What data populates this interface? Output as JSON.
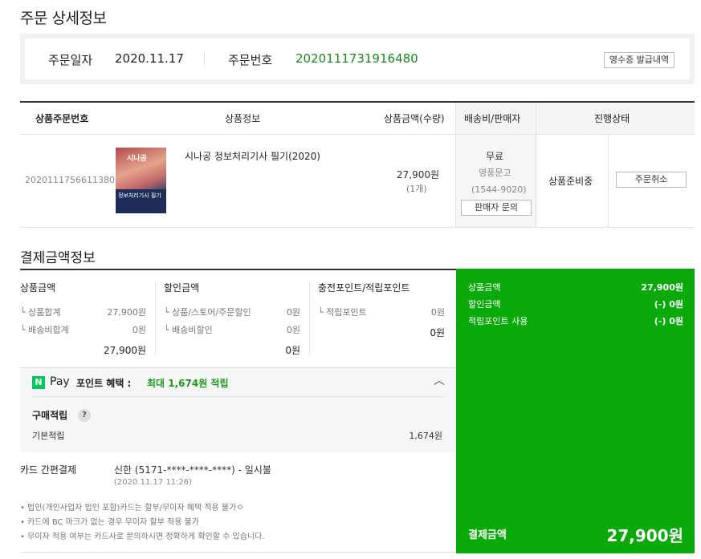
{
  "page_title": "주문 상세정보",
  "order_info": {
    "date_label": "주문일자",
    "date_value": "2020.11.17",
    "number_label": "주문번호",
    "number_value": "2020111731916480",
    "receipt_button": "영수증 발급내역"
  },
  "table": {
    "headers": {
      "item_no": "상품주문번호",
      "product": "상품정보",
      "price_qty": "상품금액(수량)",
      "ship_seller": "배송비/판매자",
      "status": "진행상태"
    },
    "row": {
      "item_no": "2020111756611380",
      "book_logo": "시나공",
      "book_band": "정보처리기사 필기",
      "product_name": "시나공 정보처리기사 필기(2020)",
      "price": "27,900원",
      "qty": "(1개)",
      "ship_fee": "무료",
      "seller": "영풍문고",
      "seller_tel": "(1544-9020)",
      "inquiry_button": "판매자 문의",
      "status": "상품준비중",
      "cancel_button": "주문취소"
    }
  },
  "payment": {
    "section_title": "결제금액정보",
    "product_col": {
      "title": "상품금액",
      "rows": [
        {
          "label": "└ 상품합계",
          "value": "27,900원"
        },
        {
          "label": "└ 배송비합계",
          "value": "0원"
        }
      ],
      "total": "27,900원"
    },
    "discount_col": {
      "title": "할인금액",
      "rows": [
        {
          "label": "└ 상품/스토어/주문할인",
          "value": "0원"
        },
        {
          "label": "└ 배송비할인",
          "value": "0원"
        }
      ],
      "total": "0원"
    },
    "point_col": {
      "title": "충전포인트/적립포인트",
      "rows": [
        {
          "label": "└ 적립포인트",
          "value": "0원"
        }
      ],
      "total": "0원"
    },
    "npay": {
      "logo": "N",
      "pay_text": "Pay",
      "benefit_text": "포인트 혜택 :",
      "benefit_highlight": "최대 1,674원 적립",
      "chevron": "︿",
      "purchase_title": "구매적립",
      "help": "?",
      "base_label": "기본적립",
      "base_value": "1,674원"
    },
    "card": {
      "label": "카드 간편결제",
      "value": "신한 (5171-****-****-****) - 일시불",
      "date": "(2020.11.17 11:26)"
    },
    "notices": [
      "• 법인(개인사업자 법인 포함)카드는 할부/무이자 혜택 적용 불가ㅇ",
      "• 카드에 BC 마크가 없는 경우 무이자 할부 적용 불가",
      "• 무이자 적용 여부는 카드사로 문의하시면 정확하게 확인할 수 있습니다."
    ]
  },
  "summary": {
    "rows": [
      {
        "label": "상품금액",
        "value": "27,900원"
      },
      {
        "label": "할인금액",
        "value": "(-) 0원"
      },
      {
        "label": "적립포인트 사용",
        "value": "(-) 0원"
      }
    ],
    "final_label": "결제금액",
    "final_value": "27,900원",
    "panel_color": "#0aaa0a"
  }
}
